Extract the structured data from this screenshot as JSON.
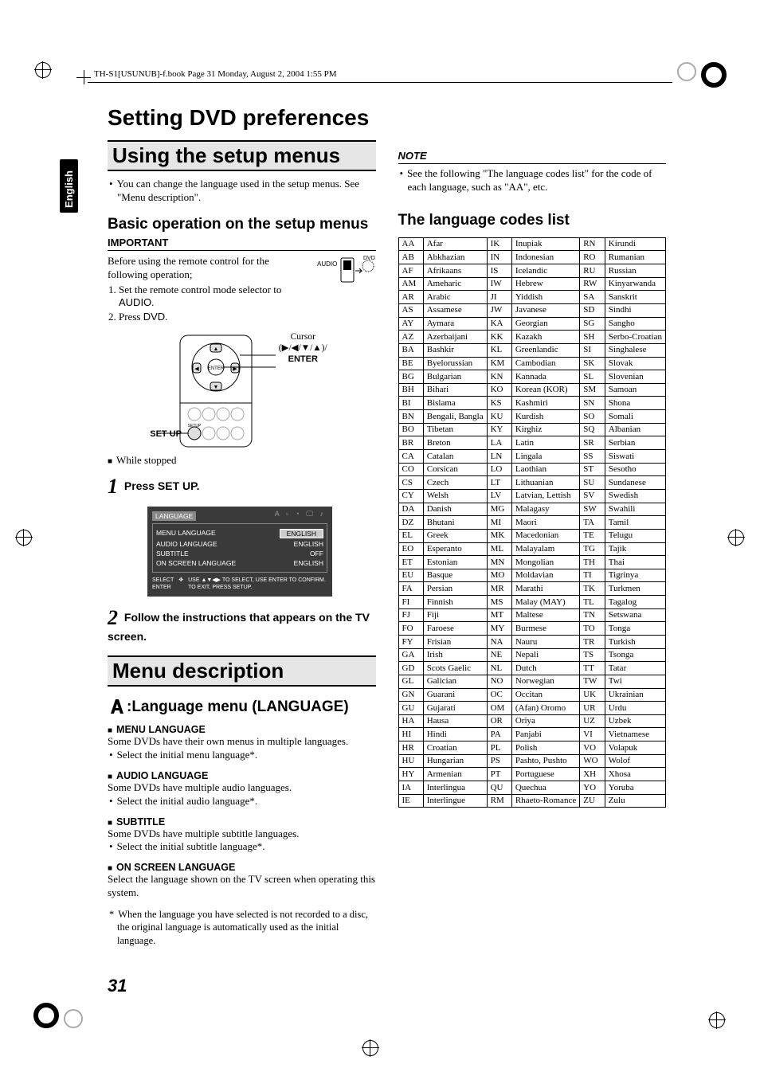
{
  "header_note": "TH-S1[USUNUB]-f.book  Page 31  Monday, August 2, 2004  1:55 PM",
  "lang_tab": "English",
  "page_number": "31",
  "title": "Setting DVD preferences",
  "section_using": "Using the setup menus",
  "using_text": "You can change the language used in the setup menus. See \"Menu description\".",
  "sub_basic": "Basic operation on the setup menus",
  "important_label": "IMPORTANT",
  "important_intro": "Before using the remote control for the following operation;",
  "important_steps": {
    "s1a": "Set the remote control mode selector to",
    "s1b": "AUDIO",
    "s2a": "Press",
    "s2b": "DVD"
  },
  "remote_labels": {
    "audio": "AUDIO",
    "dvd": "DVD",
    "cursor_label": "Cursor",
    "cursor_sym": "(▶/◀/▼/▲)/",
    "enter": "ENTER",
    "setup": "SET UP"
  },
  "while_stopped": "While stopped",
  "step1_num": "1",
  "step1_text": "Press SET UP.",
  "osd": {
    "heading": "LANGUAGE",
    "rows": [
      {
        "l": "MENU LANGUAGE",
        "r": "ENGLISH"
      },
      {
        "l": "AUDIO LANGUAGE",
        "r": "ENGLISH"
      },
      {
        "l": "SUBTITLE",
        "r": "OFF"
      },
      {
        "l": "ON SCREEN LANGUAGE",
        "r": "ENGLISH"
      }
    ],
    "foot_left": "SELECT\nENTER",
    "foot_right": "USE ▲▼◀▶ TO SELECT, USE ENTER TO CONFIRM.\nTO EXIT, PRESS SETUP."
  },
  "step2_num": "2",
  "step2_text": "Follow the instructions that appears on the TV screen.",
  "section_menu": "Menu description",
  "lang_menu_label": ":Language menu (LANGUAGE)",
  "blocks": [
    {
      "head": "MENU LANGUAGE",
      "l1": "Some DVDs have their own menus in multiple languages.",
      "l2": "Select the initial menu language*."
    },
    {
      "head": "AUDIO LANGUAGE",
      "l1": "Some DVDs have multiple audio languages.",
      "l2": "Select the initial audio language*."
    },
    {
      "head": "SUBTITLE",
      "l1": "Some DVDs have multiple subtitle languages.",
      "l2": "Select the initial subtitle language*."
    },
    {
      "head": "ON SCREEN LANGUAGE",
      "l1": "Select the language shown on the TV screen when operating this system.",
      "l2": ""
    }
  ],
  "footnote": "When the language you have selected is not recorded to a disc, the original language is automatically used as the initial language.",
  "note_label": "NOTE",
  "note_text": "See the following \"The language codes list\" for the code of each language, such as \"AA\", etc.",
  "codes_title": "The language codes list",
  "codes": [
    [
      [
        "AA",
        "Afar"
      ],
      [
        "IK",
        "Inupiak"
      ],
      [
        "RN",
        "Kirundi"
      ]
    ],
    [
      [
        "AB",
        "Abkhazian"
      ],
      [
        "IN",
        "Indonesian"
      ],
      [
        "RO",
        "Rumanian"
      ]
    ],
    [
      [
        "AF",
        "Afrikaans"
      ],
      [
        "IS",
        "Icelandic"
      ],
      [
        "RU",
        "Russian"
      ]
    ],
    [
      [
        "AM",
        "Ameharic"
      ],
      [
        "IW",
        "Hebrew"
      ],
      [
        "RW",
        "Kinyarwanda"
      ]
    ],
    [
      [
        "AR",
        "Arabic"
      ],
      [
        "JI",
        "Yiddish"
      ],
      [
        "SA",
        "Sanskrit"
      ]
    ],
    [
      [
        "AS",
        "Assamese"
      ],
      [
        "JW",
        "Javanese"
      ],
      [
        "SD",
        "Sindhi"
      ]
    ],
    [
      [
        "AY",
        "Aymara"
      ],
      [
        "KA",
        "Georgian"
      ],
      [
        "SG",
        "Sangho"
      ]
    ],
    [
      [
        "AZ",
        "Azerbaijani"
      ],
      [
        "KK",
        "Kazakh"
      ],
      [
        "SH",
        "Serbo-Croatian"
      ]
    ],
    [
      [
        "BA",
        "Bashkir"
      ],
      [
        "KL",
        "Greenlandic"
      ],
      [
        "SI",
        "Singhalese"
      ]
    ],
    [
      [
        "BE",
        "Byelorussian"
      ],
      [
        "KM",
        "Cambodian"
      ],
      [
        "SK",
        "Slovak"
      ]
    ],
    [
      [
        "BG",
        "Bulgarian"
      ],
      [
        "KN",
        "Kannada"
      ],
      [
        "SL",
        "Slovenian"
      ]
    ],
    [
      [
        "BH",
        "Bihari"
      ],
      [
        "KO",
        "Korean (KOR)"
      ],
      [
        "SM",
        "Samoan"
      ]
    ],
    [
      [
        "BI",
        "Bislama"
      ],
      [
        "KS",
        "Kashmiri"
      ],
      [
        "SN",
        "Shona"
      ]
    ],
    [
      [
        "BN",
        "Bengali, Bangla"
      ],
      [
        "KU",
        "Kurdish"
      ],
      [
        "SO",
        "Somali"
      ]
    ],
    [
      [
        "BO",
        "Tibetan"
      ],
      [
        "KY",
        "Kirghiz"
      ],
      [
        "SQ",
        "Albanian"
      ]
    ],
    [
      [
        "BR",
        "Breton"
      ],
      [
        "LA",
        "Latin"
      ],
      [
        "SR",
        "Serbian"
      ]
    ],
    [
      [
        "CA",
        "Catalan"
      ],
      [
        "LN",
        "Lingala"
      ],
      [
        "SS",
        "Siswati"
      ]
    ],
    [
      [
        "CO",
        "Corsican"
      ],
      [
        "LO",
        "Laothian"
      ],
      [
        "ST",
        "Sesotho"
      ]
    ],
    [
      [
        "CS",
        "Czech"
      ],
      [
        "LT",
        "Lithuanian"
      ],
      [
        "SU",
        "Sundanese"
      ]
    ],
    [
      [
        "CY",
        "Welsh"
      ],
      [
        "LV",
        "Latvian, Lettish"
      ],
      [
        "SV",
        "Swedish"
      ]
    ],
    [
      [
        "DA",
        "Danish"
      ],
      [
        "MG",
        "Malagasy"
      ],
      [
        "SW",
        "Swahili"
      ]
    ],
    [
      [
        "DZ",
        "Bhutani"
      ],
      [
        "MI",
        "Maori"
      ],
      [
        "TA",
        "Tamil"
      ]
    ],
    [
      [
        "EL",
        "Greek"
      ],
      [
        "MK",
        "Macedonian"
      ],
      [
        "TE",
        "Telugu"
      ]
    ],
    [
      [
        "EO",
        "Esperanto"
      ],
      [
        "ML",
        "Malayalam"
      ],
      [
        "TG",
        "Tajik"
      ]
    ],
    [
      [
        "ET",
        "Estonian"
      ],
      [
        "MN",
        "Mongolian"
      ],
      [
        "TH",
        "Thai"
      ]
    ],
    [
      [
        "EU",
        "Basque"
      ],
      [
        "MO",
        "Moldavian"
      ],
      [
        "TI",
        "Tigrinya"
      ]
    ],
    [
      [
        "FA",
        "Persian"
      ],
      [
        "MR",
        "Marathi"
      ],
      [
        "TK",
        "Turkmen"
      ]
    ],
    [
      [
        "FI",
        "Finnish"
      ],
      [
        "MS",
        "Malay (MAY)"
      ],
      [
        "TL",
        "Tagalog"
      ]
    ],
    [
      [
        "FJ",
        "Fiji"
      ],
      [
        "MT",
        "Maltese"
      ],
      [
        "TN",
        "Setswana"
      ]
    ],
    [
      [
        "FO",
        "Faroese"
      ],
      [
        "MY",
        "Burmese"
      ],
      [
        "TO",
        "Tonga"
      ]
    ],
    [
      [
        "FY",
        "Frisian"
      ],
      [
        "NA",
        "Nauru"
      ],
      [
        "TR",
        "Turkish"
      ]
    ],
    [
      [
        "GA",
        "Irish"
      ],
      [
        "NE",
        "Nepali"
      ],
      [
        "TS",
        "Tsonga"
      ]
    ],
    [
      [
        "GD",
        "Scots Gaelic"
      ],
      [
        "NL",
        "Dutch"
      ],
      [
        "TT",
        "Tatar"
      ]
    ],
    [
      [
        "GL",
        "Galician"
      ],
      [
        "NO",
        "Norwegian"
      ],
      [
        "TW",
        "Twi"
      ]
    ],
    [
      [
        "GN",
        "Guarani"
      ],
      [
        "OC",
        "Occitan"
      ],
      [
        "UK",
        "Ukrainian"
      ]
    ],
    [
      [
        "GU",
        "Gujarati"
      ],
      [
        "OM",
        "(Afan) Oromo"
      ],
      [
        "UR",
        "Urdu"
      ]
    ],
    [
      [
        "HA",
        "Hausa"
      ],
      [
        "OR",
        "Oriya"
      ],
      [
        "UZ",
        "Uzbek"
      ]
    ],
    [
      [
        "HI",
        "Hindi"
      ],
      [
        "PA",
        "Panjabi"
      ],
      [
        "VI",
        "Vietnamese"
      ]
    ],
    [
      [
        "HR",
        "Croatian"
      ],
      [
        "PL",
        "Polish"
      ],
      [
        "VO",
        "Volapuk"
      ]
    ],
    [
      [
        "HU",
        "Hungarian"
      ],
      [
        "PS",
        "Pashto, Pushto"
      ],
      [
        "WO",
        "Wolof"
      ]
    ],
    [
      [
        "HY",
        "Armenian"
      ],
      [
        "PT",
        "Portuguese"
      ],
      [
        "XH",
        "Xhosa"
      ]
    ],
    [
      [
        "IA",
        "Interlingua"
      ],
      [
        "QU",
        "Quechua"
      ],
      [
        "YO",
        "Yoruba"
      ]
    ],
    [
      [
        "IE",
        "Interlingue"
      ],
      [
        "RM",
        "Rhaeto-Romance"
      ],
      [
        "ZU",
        "Zulu"
      ]
    ]
  ]
}
